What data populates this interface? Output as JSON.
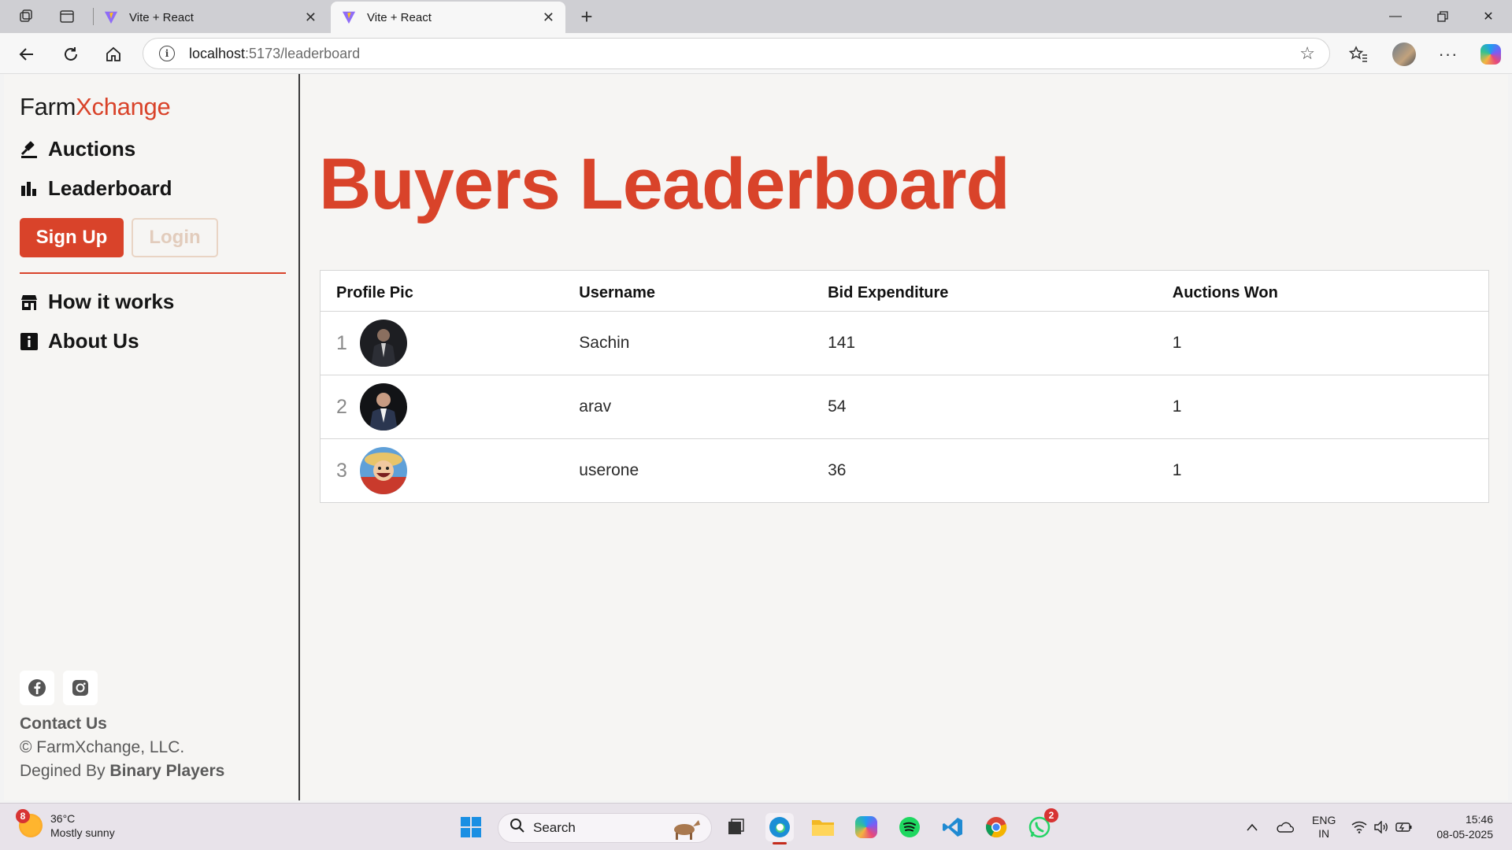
{
  "browser": {
    "tabs": [
      {
        "title": "Vite + React",
        "active": false
      },
      {
        "title": "Vite + React",
        "active": true
      }
    ],
    "url_host": "localhost",
    "url_path": ":5173/leaderboard"
  },
  "sidebar": {
    "brand_part1": "Farm",
    "brand_part2": "Xchange",
    "nav": [
      {
        "label": "Auctions",
        "icon": "gavel-icon"
      },
      {
        "label": "Leaderboard",
        "icon": "bar-chart-icon"
      }
    ],
    "signup_label": "Sign Up",
    "login_label": "Login",
    "secondary_nav": [
      {
        "label": "How it works",
        "icon": "store-icon"
      },
      {
        "label": "About Us",
        "icon": "info-icon"
      }
    ],
    "contact_label": "Contact Us",
    "copyright": "© FarmXchange, LLC.",
    "designed_prefix": "Degined By ",
    "designed_by": "Binary Players"
  },
  "main": {
    "title": "Buyers Leaderboard",
    "columns": [
      "Profile Pic",
      "Username",
      "Bid Expenditure",
      "Auctions Won"
    ],
    "rows": [
      {
        "rank": "1",
        "username": "Sachin",
        "bid_expenditure": "141",
        "auctions_won": "1"
      },
      {
        "rank": "2",
        "username": "arav",
        "bid_expenditure": "54",
        "auctions_won": "1"
      },
      {
        "rank": "3",
        "username": "userone",
        "bid_expenditure": "36",
        "auctions_won": "1"
      }
    ]
  },
  "taskbar": {
    "weather_badge": "8",
    "temperature": "36°C",
    "weather_desc": "Mostly sunny",
    "search_placeholder": "Search",
    "whatsapp_badge": "2",
    "lang": "ENG",
    "region": "IN",
    "time": "15:46",
    "date": "08-05-2025"
  },
  "colors": {
    "accent": "#d9432a",
    "page_bg": "#f6f5f3"
  }
}
